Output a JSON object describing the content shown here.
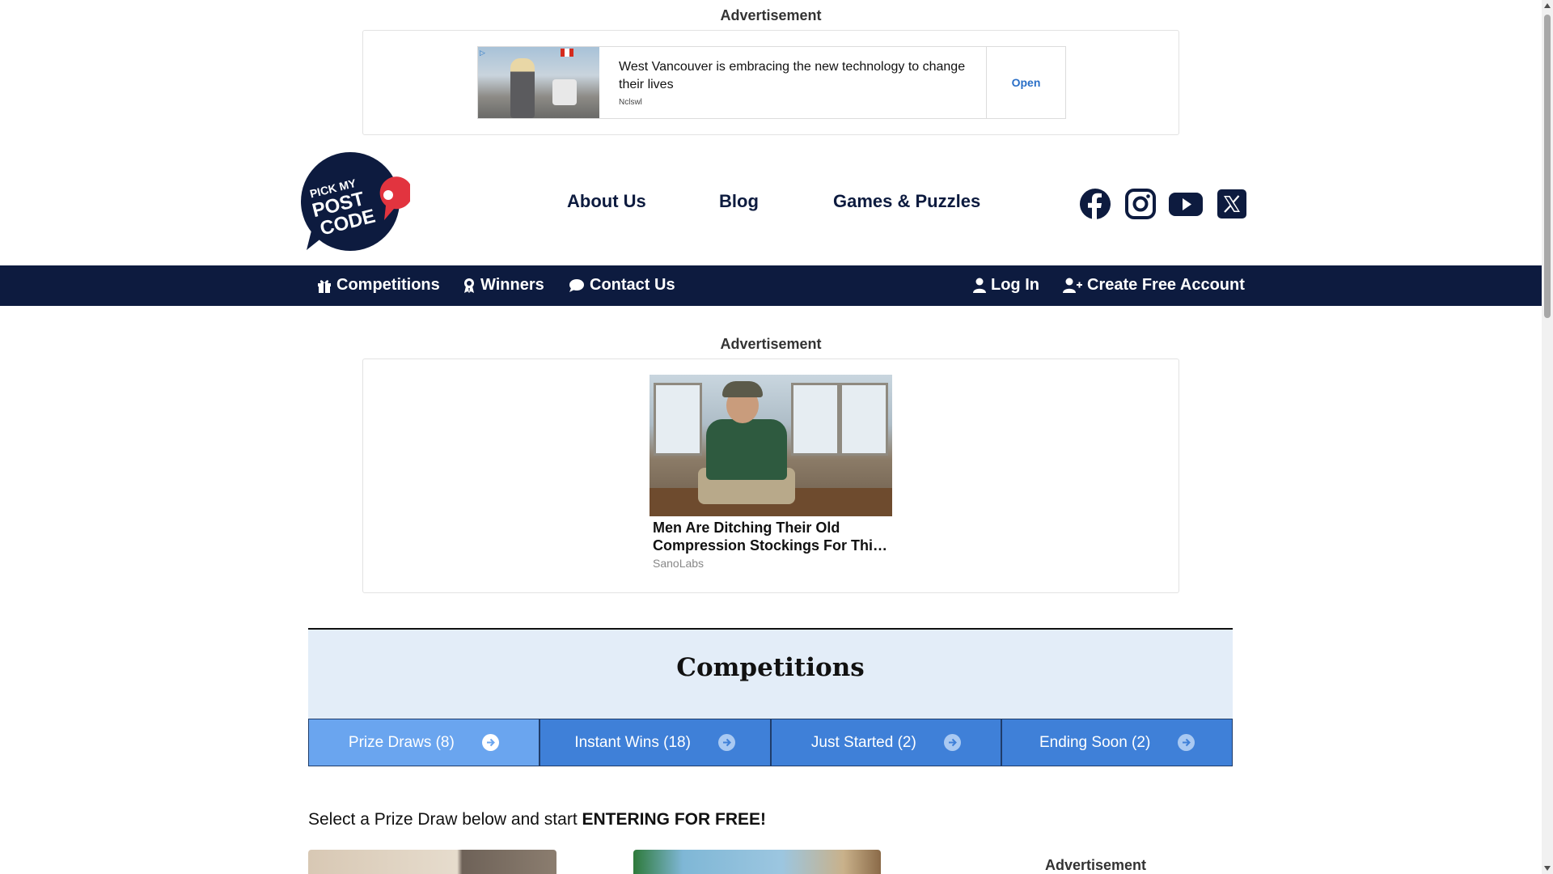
{
  "top_ad": {
    "label": "Advertisement",
    "headline": "West Vancouver is embracing the new technology to change their lives",
    "source": "Nclswl",
    "cta": "Open"
  },
  "header": {
    "logo_text": [
      "PICK MY",
      "POST",
      "CODE"
    ],
    "links": [
      "About Us",
      "Blog",
      "Games & Puzzles"
    ],
    "social_icons": [
      "facebook-icon",
      "instagram-icon",
      "youtube-icon",
      "x-icon"
    ]
  },
  "navbar": {
    "left": [
      {
        "label": "Competitions",
        "icon": "gift-icon"
      },
      {
        "label": "Winners",
        "icon": "award-icon"
      },
      {
        "label": "Contact Us",
        "icon": "chat-icon"
      }
    ],
    "right": [
      {
        "label": "Log In",
        "icon": "user-icon"
      },
      {
        "label": "Create Free Account",
        "icon": "user-plus-icon"
      }
    ]
  },
  "mid_ad": {
    "label": "Advertisement",
    "title": "Men Are Ditching Their Old Compression Stockings For Thi…",
    "source": "SanoLabs"
  },
  "competitions": {
    "title": "Competitions",
    "tabs": [
      {
        "label": "Prize Draws (8)",
        "active": true
      },
      {
        "label": "Instant Wins (18)",
        "active": false
      },
      {
        "label": "Just Started (2)",
        "active": false
      },
      {
        "label": "Ending Soon (2)",
        "active": false
      }
    ],
    "select_prefix": "Select a Prize Draw below and start ",
    "select_emphasis": "ENTERING FOR FREE!"
  },
  "side_ad": {
    "label": "Advertisement"
  },
  "colors": {
    "navy": "#0d1b3f",
    "tab_blue": "#3f80d8",
    "tab_active": "#6aa5ef",
    "panel_bg": "#e3edf8",
    "logo_pin": "#e2343f"
  }
}
